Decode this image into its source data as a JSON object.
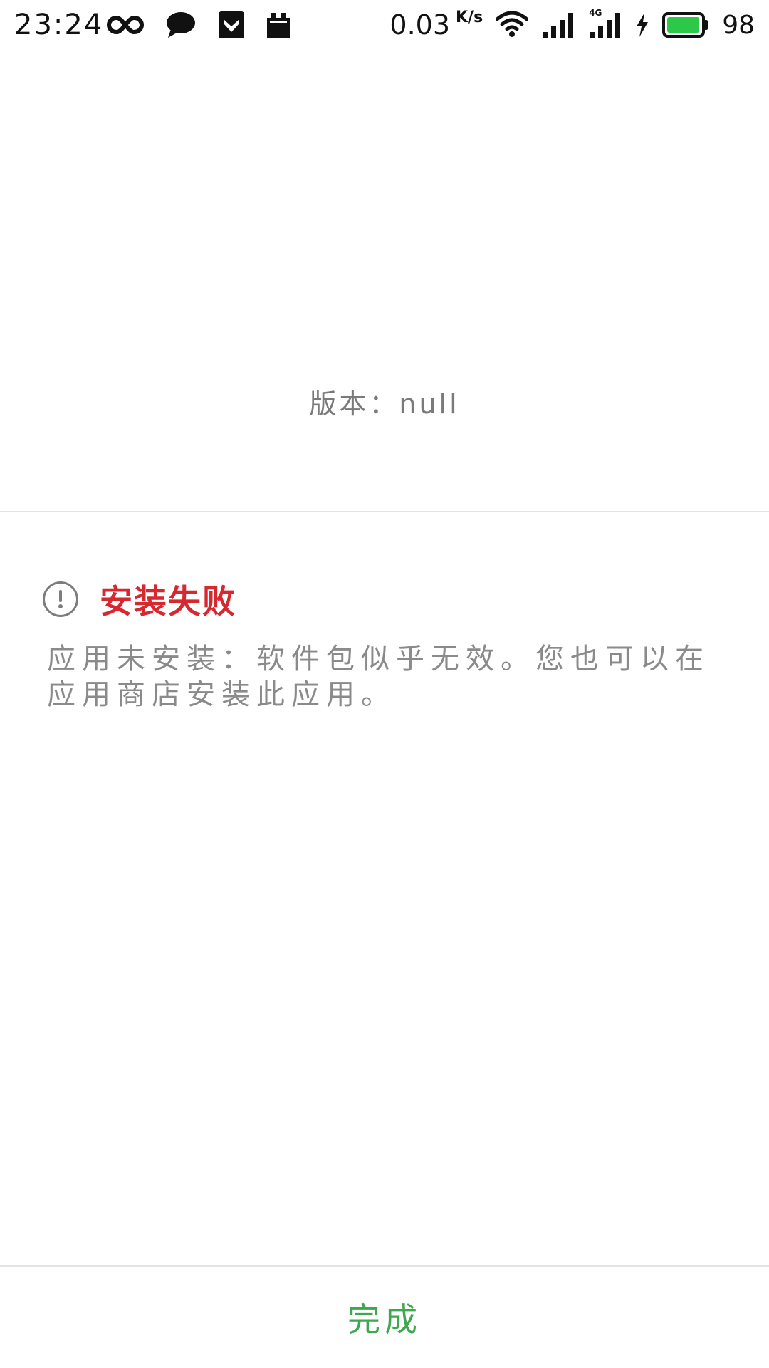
{
  "status_bar": {
    "time": "23:24",
    "left_icons": [
      "infinity-icon",
      "chat-bubble-icon",
      "shield-icon",
      "calendar-icon"
    ],
    "net_speed": "0.03",
    "net_speed_unit": "K/s",
    "network_type": "4G",
    "battery_level": "98",
    "battery_color": "#2bc84a"
  },
  "app": {
    "version_label": "版本：",
    "version_value": "null"
  },
  "result": {
    "title": "安装失败",
    "message": "应用未安装：软件包似乎无效。您也可以在应用商店安装此应用。",
    "title_color": "#d7282f"
  },
  "footer": {
    "done_label": "完成",
    "accent_color": "#3da84f"
  }
}
